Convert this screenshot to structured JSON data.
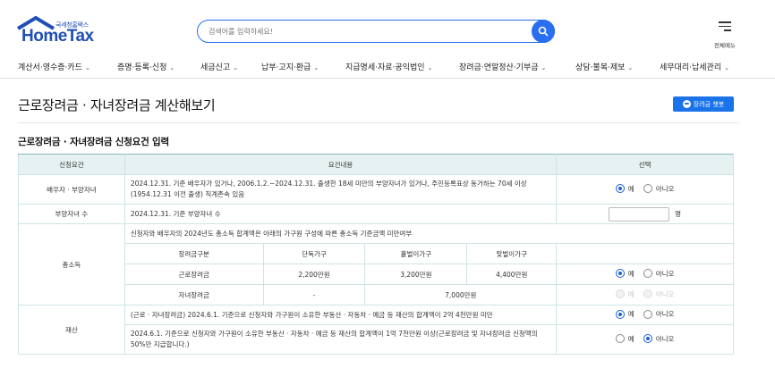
{
  "header": {
    "logo_sub": "국세청홈택스",
    "logo_text": "HomeTax",
    "search_placeholder": "검색어를 입력하세요!",
    "menu_label": "전체메뉴"
  },
  "nav": [
    {
      "label": "계산서·영수증·카드"
    },
    {
      "label": "증명·등록·신청"
    },
    {
      "label": "세금신고"
    },
    {
      "label": "납부·고지·환급"
    },
    {
      "label": "지급명세·자료·공익법인"
    },
    {
      "label": "장려금·연말정산·기부금"
    },
    {
      "label": "상담·불복·제보"
    },
    {
      "label": "세무대리·납세관리"
    }
  ],
  "page": {
    "title": "근로장려금 · 자녀장려금 계산해보기",
    "chatbot_label": "장려금 챗봇",
    "section_title": "근로장려금 · 자녀장려금 신청요건 입력"
  },
  "table": {
    "headers": [
      "신청요건",
      "요건내용",
      "선택"
    ],
    "spouse": {
      "label": "배우자 · 부양자녀",
      "desc": "2024.12.31. 기준 배우자가 있거나, 2006.1.2.~2024.12.31. 출생한 18세 미만의 부양자녀가 있거나, 주민등록표상 동거하는 70세 이상(1954.12.31 이전 출생) 직계존속 있음"
    },
    "children": {
      "label": "부양자녀 수",
      "desc": "2024.12.31. 기준 부양자녀 수",
      "unit": "명"
    },
    "income": {
      "label": "총소득",
      "desc": "신청자와 배우자의 2024년도 총소득 합계액은 아래의 가구원 구성에 따른 총소득 기준금액 미만여부",
      "sub_headers": [
        "장려금구분",
        "단독가구",
        "홑벌이가구",
        "맞벌이가구"
      ],
      "work_row": [
        "근로장려금",
        "2,200만원",
        "3,200만원",
        "4,400만원"
      ],
      "child_row": [
        "자녀장려금",
        "-",
        "7,000만원"
      ]
    },
    "assets": {
      "label": "재산",
      "desc1": "(근로 · 자녀장려금) 2024.6.1. 기준으로 신청자와 가구원이 소유한 부동산 · 자동차 · 예금 등 재산의 합계액이 2억 4천만원 미만",
      "desc2": "2024.6.1. 기준으로 신청자와 가구원이 소유한 부동산 · 자동차 · 예금 등 재산의 합계액이 1억 7천만원 이상(근로장려금 및 자녀장려금 신청액의 50%만 지급합니다.)"
    },
    "yes": "예",
    "no": "아니오"
  }
}
